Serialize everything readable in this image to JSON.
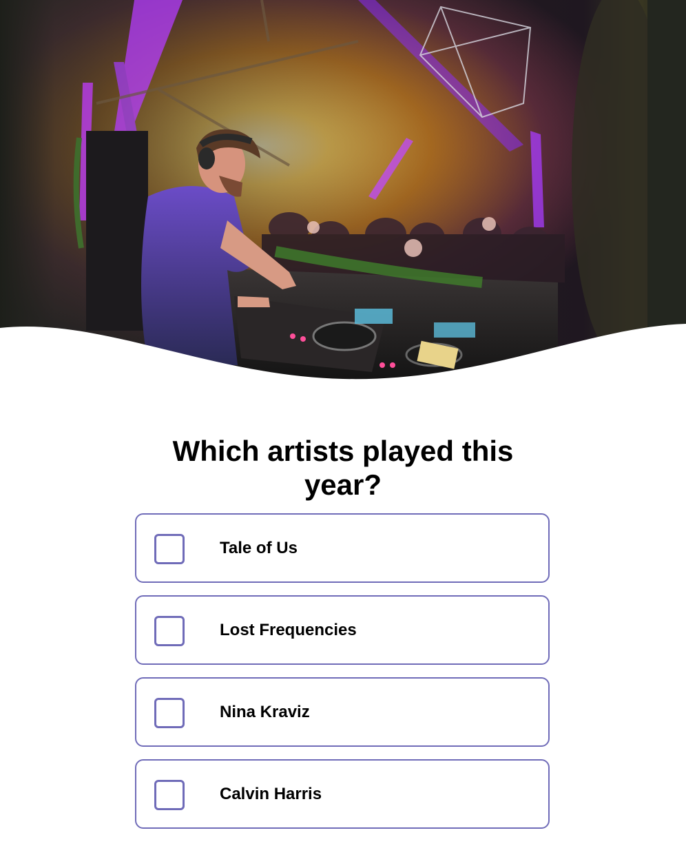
{
  "hero": {
    "image_description_icon": "dj-photo-icon"
  },
  "question": {
    "title": "Which artists played this year?"
  },
  "options": [
    {
      "label": "Tale of Us",
      "checked": false
    },
    {
      "label": "Lost Frequencies",
      "checked": false
    },
    {
      "label": "Nina Kraviz",
      "checked": false
    },
    {
      "label": "Calvin Harris",
      "checked": false
    }
  ],
  "colors": {
    "accent": "#6f6bb8",
    "text": "#000000",
    "background": "#ffffff"
  }
}
